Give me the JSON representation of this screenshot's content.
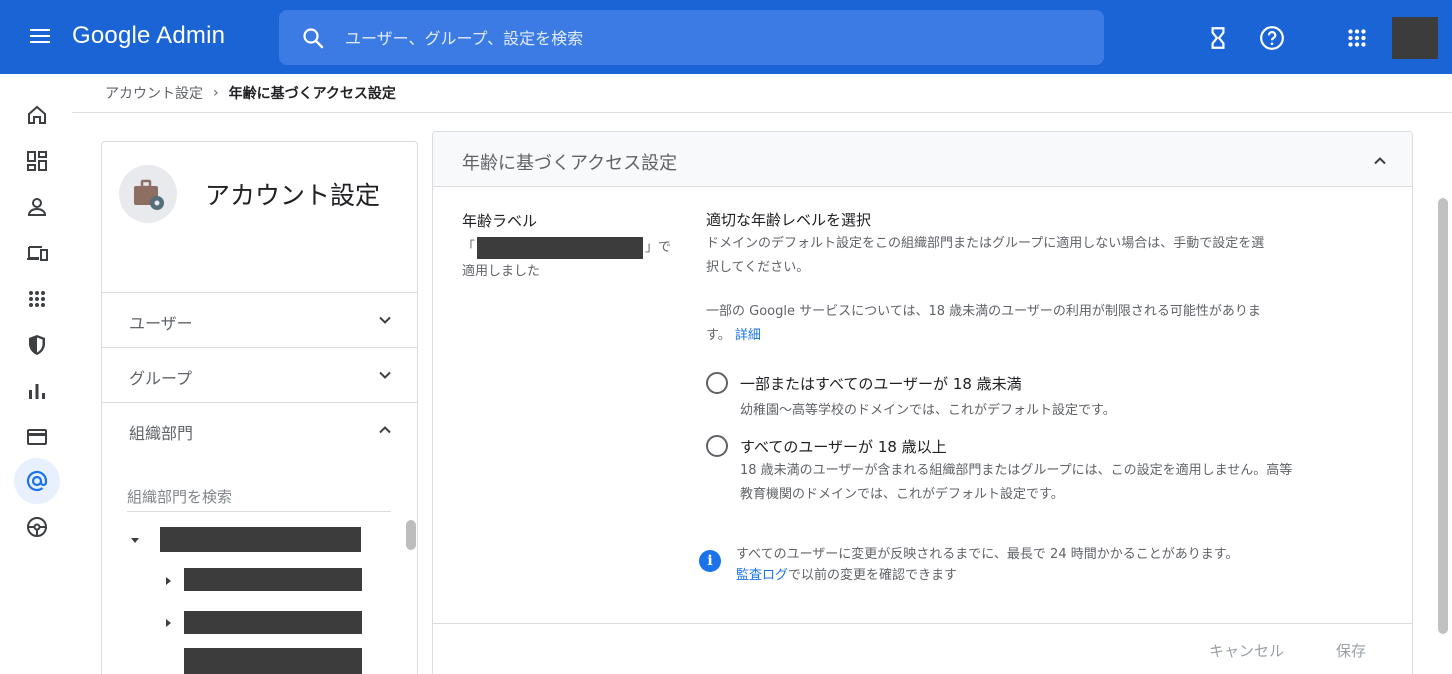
{
  "topbar": {
    "logo": "Google Admin",
    "search_placeholder": "ユーザー、グループ、設定を検索",
    "icons": [
      "menu-icon",
      "search-icon",
      "hourglass-icon",
      "help-icon",
      "apps-grid-icon",
      "avatar"
    ],
    "color": "#1a64d6"
  },
  "rail": {
    "icons": [
      "home-icon",
      "dashboard-icon",
      "user-icon",
      "devices-icon",
      "apps-icon",
      "security-shield-icon",
      "reports-bar-chart-icon",
      "billing-card-icon",
      "account-at-icon",
      "rules-icon"
    ],
    "active": "account-at-icon"
  },
  "breadcrumb": {
    "parent": "アカウント設定",
    "separator": "›",
    "current": "年齢に基づくアクセス設定"
  },
  "left_panel": {
    "title": "アカウント設定",
    "sections": [
      {
        "label": "ユーザー",
        "expanded": false
      },
      {
        "label": "グループ",
        "expanded": false
      },
      {
        "label": "組織部門",
        "expanded": true
      }
    ],
    "ou_search_placeholder": "組織部門を検索"
  },
  "right_panel": {
    "title": "年齢に基づくアクセス設定",
    "age_label": "年齢ラベル",
    "applied_prefix": "「",
    "applied_suffix": "」で",
    "applied_line2": "適用しました",
    "select_heading": "適切な年齢レベルを選択",
    "desc1": "ドメインのデフォルト設定をこの組織部門またはグループに適用しない場合は、手動で設定を選択してください。",
    "desc2": "一部の Google サービスについては、18 歳未満のユーザーの利用が制限される可能性があります。",
    "details_link": "詳細",
    "options": [
      {
        "label": "一部またはすべてのユーザーが 18 歳未満",
        "sub": "幼稚園〜高等学校のドメインでは、これがデフォルト設定です。",
        "selected": false
      },
      {
        "label": "すべてのユーザーが 18 歳以上",
        "sub": "18 歳未満のユーザーが含まれる組織部門またはグループには、この設定を適用しません。高等教育機関のドメインでは、これがデフォルト設定です。",
        "selected": false
      }
    ],
    "info_line1": "すべてのユーザーに変更が反映されるまでに、最長で 24 時間かかることがあります。",
    "info_link": "監査ログ",
    "info_line2_suffix": "で以前の変更を確認できます",
    "cancel": "キャンセル",
    "save": "保存"
  }
}
